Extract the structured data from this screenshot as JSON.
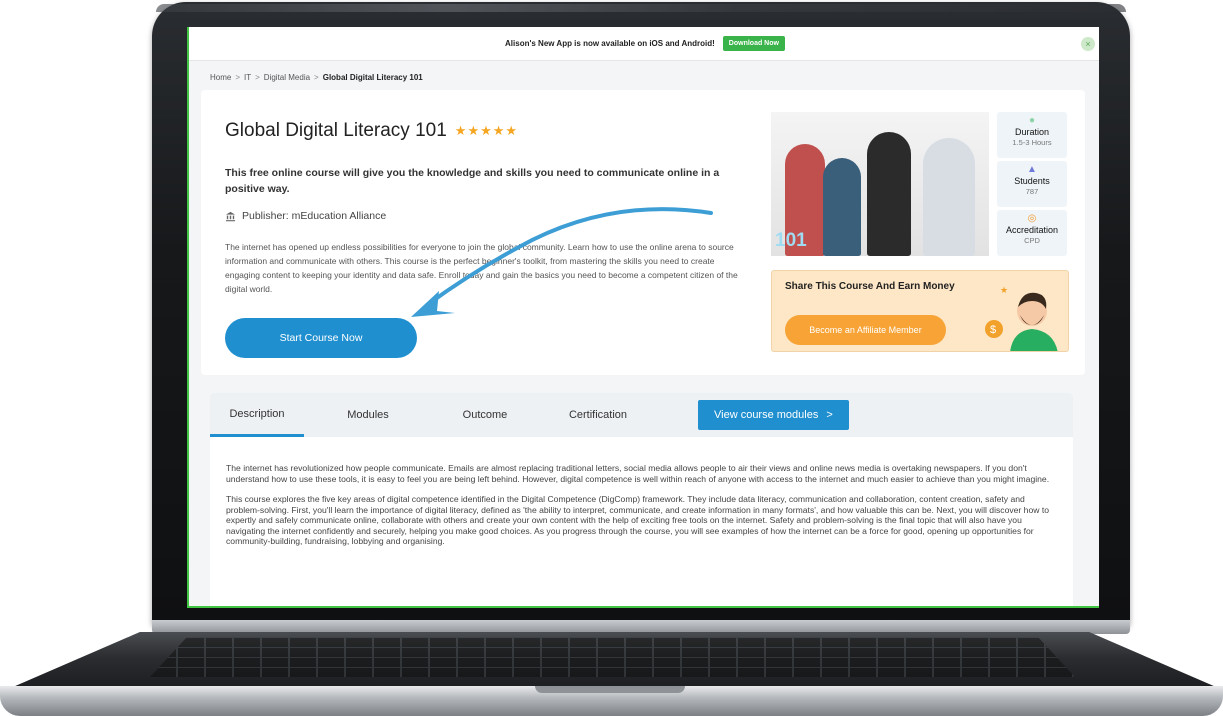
{
  "banner": {
    "text": "Alison's New App is now available on iOS and Android!",
    "button": "Download Now",
    "close_icon": "close-icon"
  },
  "breadcrumb": {
    "items": [
      "Home",
      "IT",
      "Digital Media"
    ],
    "current": "Global Digital Literacy 101",
    "separator": ">"
  },
  "course": {
    "title": "Global Digital Literacy 101",
    "stars": "★★★★★",
    "headline": "This free online course will give you the knowledge and skills you need to communicate online in a positive way.",
    "publisher": "Publisher: mEducation Alliance",
    "summary": "The internet has opened up endless possibilities for everyone to join the global community. Learn how to use the online arena to source information and communicate with others. This course is the perfect beginner's toolkit, from mastering the skills you need to create engaging content to keeping your identity and data safe. Enroll today and gain the basics you need to become a competent citizen of the digital world.",
    "start_button": "Start Course Now",
    "image_label": "101"
  },
  "stats": [
    {
      "icon": "clock-icon",
      "label": "Duration",
      "value": "1.5-3 Hours"
    },
    {
      "icon": "graduation-cap-icon",
      "label": "Students",
      "value": "787"
    },
    {
      "icon": "medal-icon",
      "label": "Accreditation",
      "value": "CPD"
    }
  ],
  "affiliate": {
    "title": "Share This Course And Earn Money",
    "button": "Become an Affiliate Member"
  },
  "tabs": [
    "Description",
    "Modules",
    "Outcome",
    "Certification"
  ],
  "view_modules": "View course modules",
  "description": {
    "p1": "The internet has revolutionized how people communicate. Emails are almost replacing traditional letters, social media allows people to air their views and online news media is overtaking newspapers. If you don't understand how to use these tools, it is easy to feel you are being left behind. However, digital competence is well within reach of anyone with access to the internet and much easier to achieve than you might imagine.",
    "p2": "This course explores the five key areas of digital competence identified in the Digital Competence (DigComp) framework. They include data literacy, communication and collaboration, content creation, safety and problem-solving. First, you'll learn the importance of digital literacy, defined as 'the ability to interpret, communicate, and create information in many formats', and how valuable this can be. Next, you will discover how to expertly and safely communicate online, collaborate with others and create your own content with the help of exciting free tools on the internet. Safety and problem-solving is the final topic that will also have you navigating the internet confidently and securely, helping you make good choices. As you progress through the course, you will see examples of how the internet can be a force for good, opening up opportunities for community-building, fundraising, lobbying and organising."
  },
  "colors": {
    "accent": "#1f8fcf",
    "download_green": "#3ab34a",
    "affiliate_orange": "#f7a335",
    "star": "#f5a623"
  }
}
